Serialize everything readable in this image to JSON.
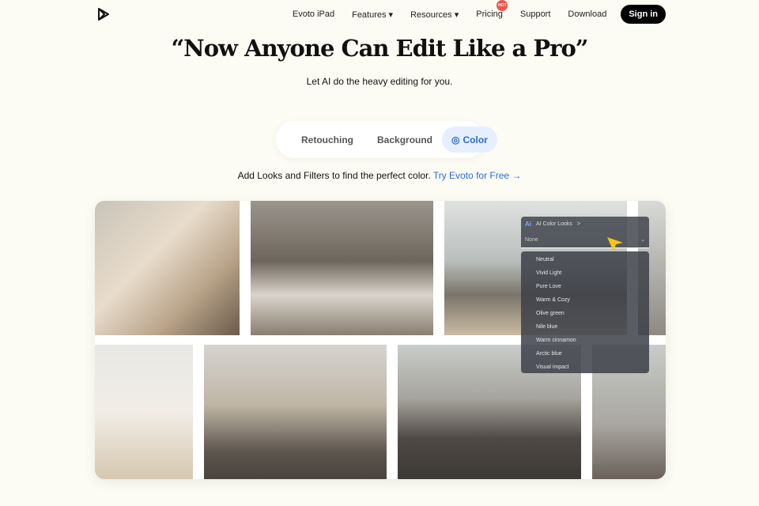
{
  "nav": {
    "items": [
      "Evoto iPad",
      "Features ▾",
      "Resources ▾",
      "Pricing",
      "Support",
      "Download"
    ],
    "hot_badge": "HOT",
    "signin": "Sign in"
  },
  "hero": {
    "title": "“Now Anyone Can Edit Like a Pro”",
    "subtitle": "Let AI do the heavy editing for you."
  },
  "tabs": [
    {
      "label": "Retouching"
    },
    {
      "label": "Background"
    },
    {
      "label": "Color",
      "active": true,
      "icon": "palette-icon"
    }
  ],
  "tagline": {
    "text": "Add Looks and Filters to find the perfect color.",
    "link": "Try Evoto for Free →"
  },
  "panel": {
    "logo": "Ai",
    "title": "AI Color Looks",
    "chevron": ">",
    "selected": "None",
    "options": [
      "Neutral",
      "Vivid Light",
      "Pure Love",
      "Warm & Cozy",
      "Olive green",
      "Nile blue",
      "Warm cinnamon",
      "Arctic blue",
      "Visual impact"
    ]
  },
  "colors": {
    "accent": "#2a6bd8",
    "hot": "#f0544a",
    "cursor": "#f5c518"
  }
}
